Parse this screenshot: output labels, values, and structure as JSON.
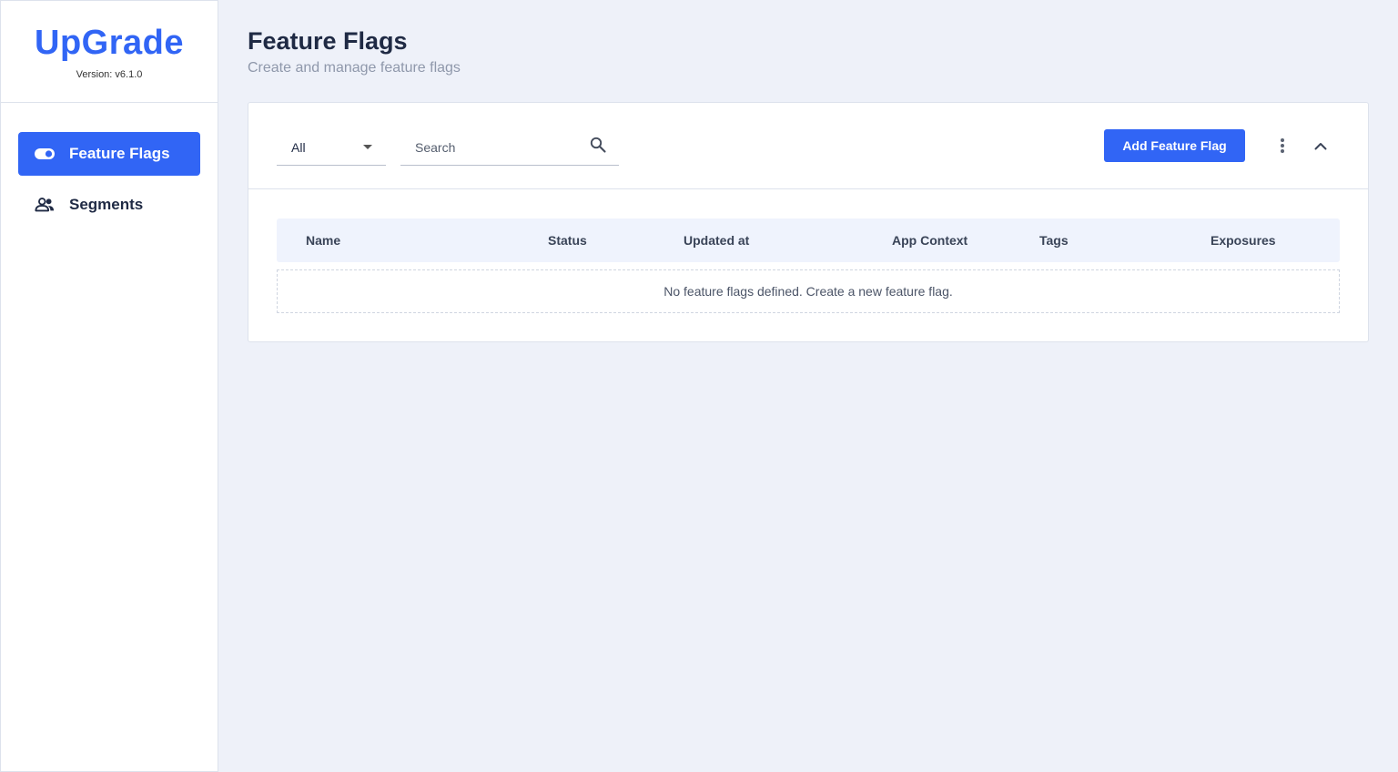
{
  "brand": {
    "name": "UpGrade",
    "version": "Version: v6.1.0"
  },
  "sidebar": {
    "items": [
      {
        "label": "Feature Flags",
        "icon": "toggle-icon",
        "active": true
      },
      {
        "label": "Segments",
        "icon": "people-icon",
        "active": false
      }
    ]
  },
  "header": {
    "title": "Feature Flags",
    "subtitle": "Create and manage feature flags"
  },
  "toolbar": {
    "filter_selected": "All",
    "search_placeholder": "Search",
    "add_button_label": "Add Feature Flag"
  },
  "table": {
    "columns": [
      "Name",
      "Status",
      "Updated at",
      "App Context",
      "Tags",
      "Exposures"
    ],
    "empty_message": "No feature flags defined. Create a new feature flag."
  },
  "colors": {
    "accent": "#3165f5",
    "background": "#eef1f9",
    "header_row": "#eff3fd"
  }
}
